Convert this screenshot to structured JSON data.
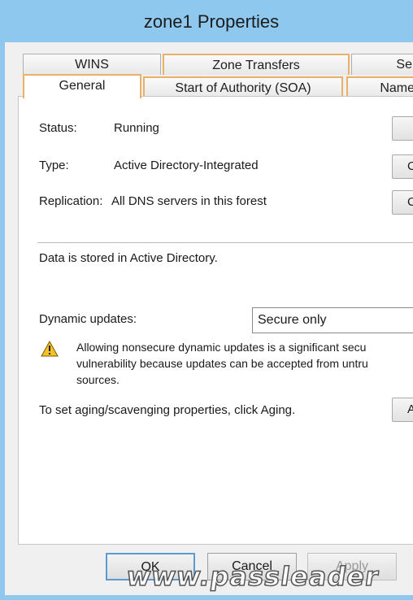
{
  "window": {
    "title": "zone1 Properties"
  },
  "tabs_back": [
    {
      "label": "WINS"
    },
    {
      "label": "Zone Transfers"
    },
    {
      "label": "Se"
    }
  ],
  "tabs_front": [
    {
      "label": "General"
    },
    {
      "label": "Start of Authority (SOA)"
    },
    {
      "label": "Name"
    }
  ],
  "general": {
    "status_label": "Status:",
    "status_value": "Running",
    "type_label": "Type:",
    "type_value": "Active Directory-Integrated",
    "replication_label": "Replication:",
    "replication_value": "All DNS servers in this forest",
    "type_button": "C",
    "replication_button": "C",
    "storage_text": "Data is stored in Active Directory.",
    "dynamic_label": "Dynamic updates:",
    "dynamic_value": "Secure only",
    "warning_line1": "Allowing nonsecure dynamic updates is a significant secu",
    "warning_line2": "vulnerability because updates can be accepted from untru",
    "warning_line3": "sources.",
    "aging_text": "To set aging/scavenging properties, click Aging.",
    "aging_button": "A"
  },
  "buttons": {
    "ok": "OK",
    "cancel": "Cancel",
    "apply": "Apply"
  },
  "watermark": "www.passleader",
  "icons": {
    "warning": "warning-icon"
  }
}
